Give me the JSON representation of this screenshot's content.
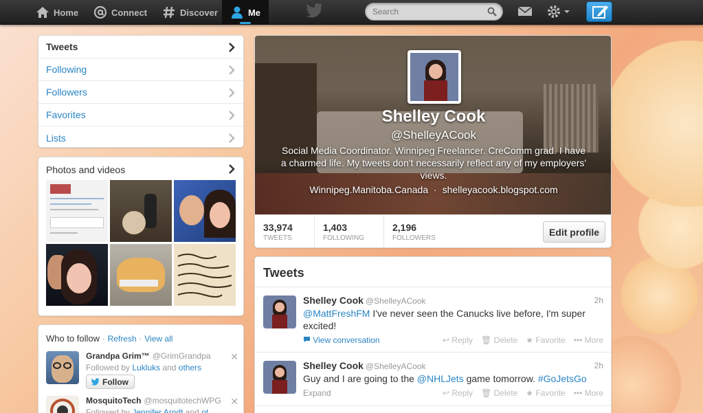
{
  "nav": {
    "home": "Home",
    "connect": "Connect",
    "discover": "Discover",
    "me": "Me",
    "search_placeholder": "Search"
  },
  "sidebar": {
    "items": [
      {
        "label": "Tweets"
      },
      {
        "label": "Following"
      },
      {
        "label": "Followers"
      },
      {
        "label": "Favorites"
      },
      {
        "label": "Lists"
      }
    ],
    "photos_title": "Photos and videos"
  },
  "who_to_follow": {
    "title": "Who to follow",
    "refresh": "Refresh",
    "view_all": "View all",
    "separator": "·",
    "suggestions": [
      {
        "name": "Grandpa Grim™",
        "handle": "@GrimGrandpa",
        "followed_by_prefix": "Followed by",
        "followed_by_name": "Lukluks",
        "followed_by_and": "and",
        "followed_by_rest": "others",
        "follow_label": "Follow"
      },
      {
        "name": "MosquitoTech",
        "handle": "@mosquitotechWPG",
        "followed_by_prefix": "Followed by",
        "followed_by_name": "Jennifer Arndt",
        "followed_by_and": "and",
        "followed_by_rest": "ot..."
      }
    ]
  },
  "profile": {
    "name": "Shelley Cook",
    "handle": "@ShelleyACook",
    "bio": "Social Media Coordinator. Winnipeg Freelancer. CreComm grad. I have a charmed life. My tweets don't necessarily reflect any of my employers' views.",
    "location": "Winnipeg.Manitoba.Canada",
    "dot": "·",
    "website": "shelleyacook.blogspot.com",
    "stats": [
      {
        "value": "33,974",
        "label": "TWEETS"
      },
      {
        "value": "1,403",
        "label": "FOLLOWING"
      },
      {
        "value": "2,196",
        "label": "FOLLOWERS"
      }
    ],
    "edit_label": "Edit profile"
  },
  "tweets": {
    "title": "Tweets",
    "items": [
      {
        "name": "Shelley Cook",
        "handle": "@ShelleyACook",
        "time": "2h",
        "mention": "@MattFreshFM",
        "text": " I've never seen the Canucks live before, I'm super excited!",
        "footer": "View conversation",
        "actions": {
          "reply": "Reply",
          "delete": "Delete",
          "favorite": "Favorite",
          "more": "More"
        }
      },
      {
        "name": "Shelley Cook",
        "handle": "@ShelleyACook",
        "time": "2h",
        "text_before": "Guy and I are going to the ",
        "mention": "@NHLJets",
        "text_middle": " game tomorrow. ",
        "hashtag": "#GoJetsGo",
        "footer": "Expand",
        "actions": {
          "reply": "Reply",
          "delete": "Delete",
          "favorite": "Favorite",
          "more": "More"
        }
      }
    ]
  },
  "colors": {
    "link": "#2a85c5",
    "topbar": "#222222",
    "accent": "#2fa5e5"
  }
}
